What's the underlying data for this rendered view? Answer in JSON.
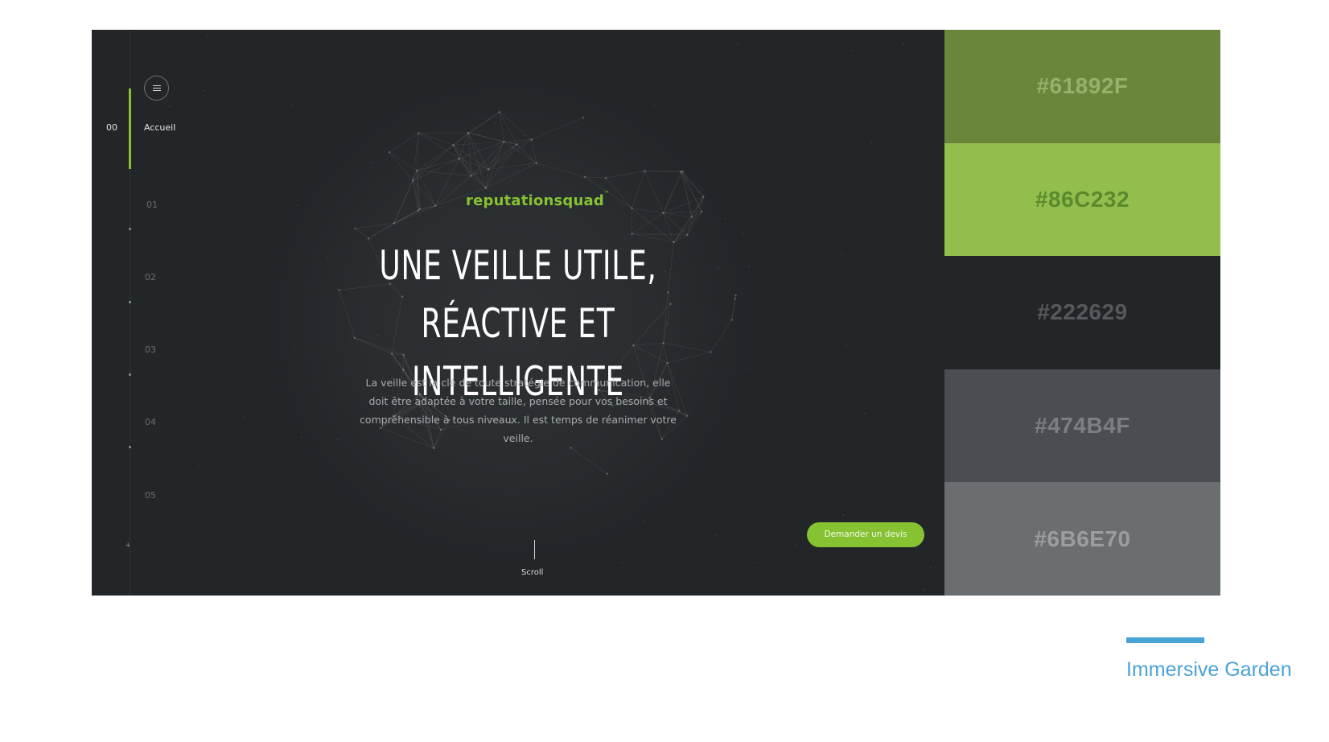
{
  "nav": {
    "active_index": "00",
    "active_label": "Accueil",
    "indices": [
      "01",
      "02",
      "03",
      "04",
      "05"
    ]
  },
  "hero": {
    "brand": "reputationsquad",
    "brand_mark": "™",
    "headline_line1": "UNE VEILLE UTILE,",
    "headline_line2": "RÉACTIVE ET INTELLIGENTE",
    "lead": "La veille est la clé de toute stratégie de communication, elle doit être adaptée à votre taille, pensée pour vos besoins et compréhensible à tous niveaux. Il est temps de réanimer votre veille.",
    "cta_label": "Demander un devis",
    "scroll_label": "Scroll"
  },
  "icons": {
    "menu": "hamburger-menu-icon"
  },
  "palette": [
    {
      "label": "#61892F",
      "bg": "#69863a",
      "text": "#94b26a"
    },
    {
      "label": "#86C232",
      "bg": "#92bf4c",
      "text": "#5a8a2d"
    },
    {
      "label": "#222629",
      "bg": "#222629",
      "text": "#55595c"
    },
    {
      "label": "#474B4F",
      "bg": "#4a4d51",
      "text": "#7b7f82"
    },
    {
      "label": "#6B6E70",
      "bg": "#6b6e70",
      "text": "#9b9ea0"
    }
  ],
  "credit": "Immersive Garden",
  "colors": {
    "accent": "#86C232",
    "background": "#222629",
    "credit": "#4aa3d6"
  }
}
